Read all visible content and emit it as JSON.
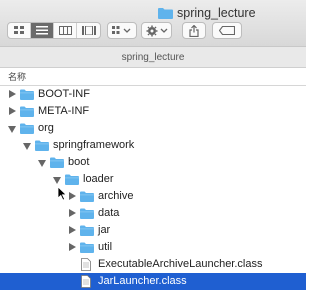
{
  "window": {
    "title": "spring_lecture",
    "path_title": "spring_lecture"
  },
  "toolbar": {
    "view_modes": [
      "icon-view",
      "list-view",
      "column-view",
      "gallery-view"
    ],
    "active_view": "list-view",
    "arrange_icon": "grid-arrange-icon",
    "action_icon": "gear-icon",
    "share_icon": "share-icon",
    "tag_icon": "tag-icon"
  },
  "list": {
    "column_header": "名称",
    "rows": [
      {
        "label": "BOOT-INF",
        "type": "folder",
        "depth": 0,
        "state": "collapsed"
      },
      {
        "label": "META-INF",
        "type": "folder",
        "depth": 0,
        "state": "collapsed"
      },
      {
        "label": "org",
        "type": "folder",
        "depth": 0,
        "state": "expanded"
      },
      {
        "label": "springframework",
        "type": "folder",
        "depth": 1,
        "state": "expanded"
      },
      {
        "label": "boot",
        "type": "folder",
        "depth": 2,
        "state": "expanded"
      },
      {
        "label": "loader",
        "type": "folder",
        "depth": 3,
        "state": "expanded"
      },
      {
        "label": "archive",
        "type": "folder",
        "depth": 4,
        "state": "collapsed"
      },
      {
        "label": "data",
        "type": "folder",
        "depth": 4,
        "state": "collapsed"
      },
      {
        "label": "jar",
        "type": "folder",
        "depth": 4,
        "state": "collapsed"
      },
      {
        "label": "util",
        "type": "folder",
        "depth": 4,
        "state": "collapsed"
      },
      {
        "label": "ExecutableArchiveLauncher.class",
        "type": "file",
        "depth": 4
      },
      {
        "label": "JarLauncher.class",
        "type": "file",
        "depth": 4,
        "selected": true
      }
    ]
  },
  "colors": {
    "selection": "#1f5fd1",
    "folder": "#5fb3ec"
  }
}
